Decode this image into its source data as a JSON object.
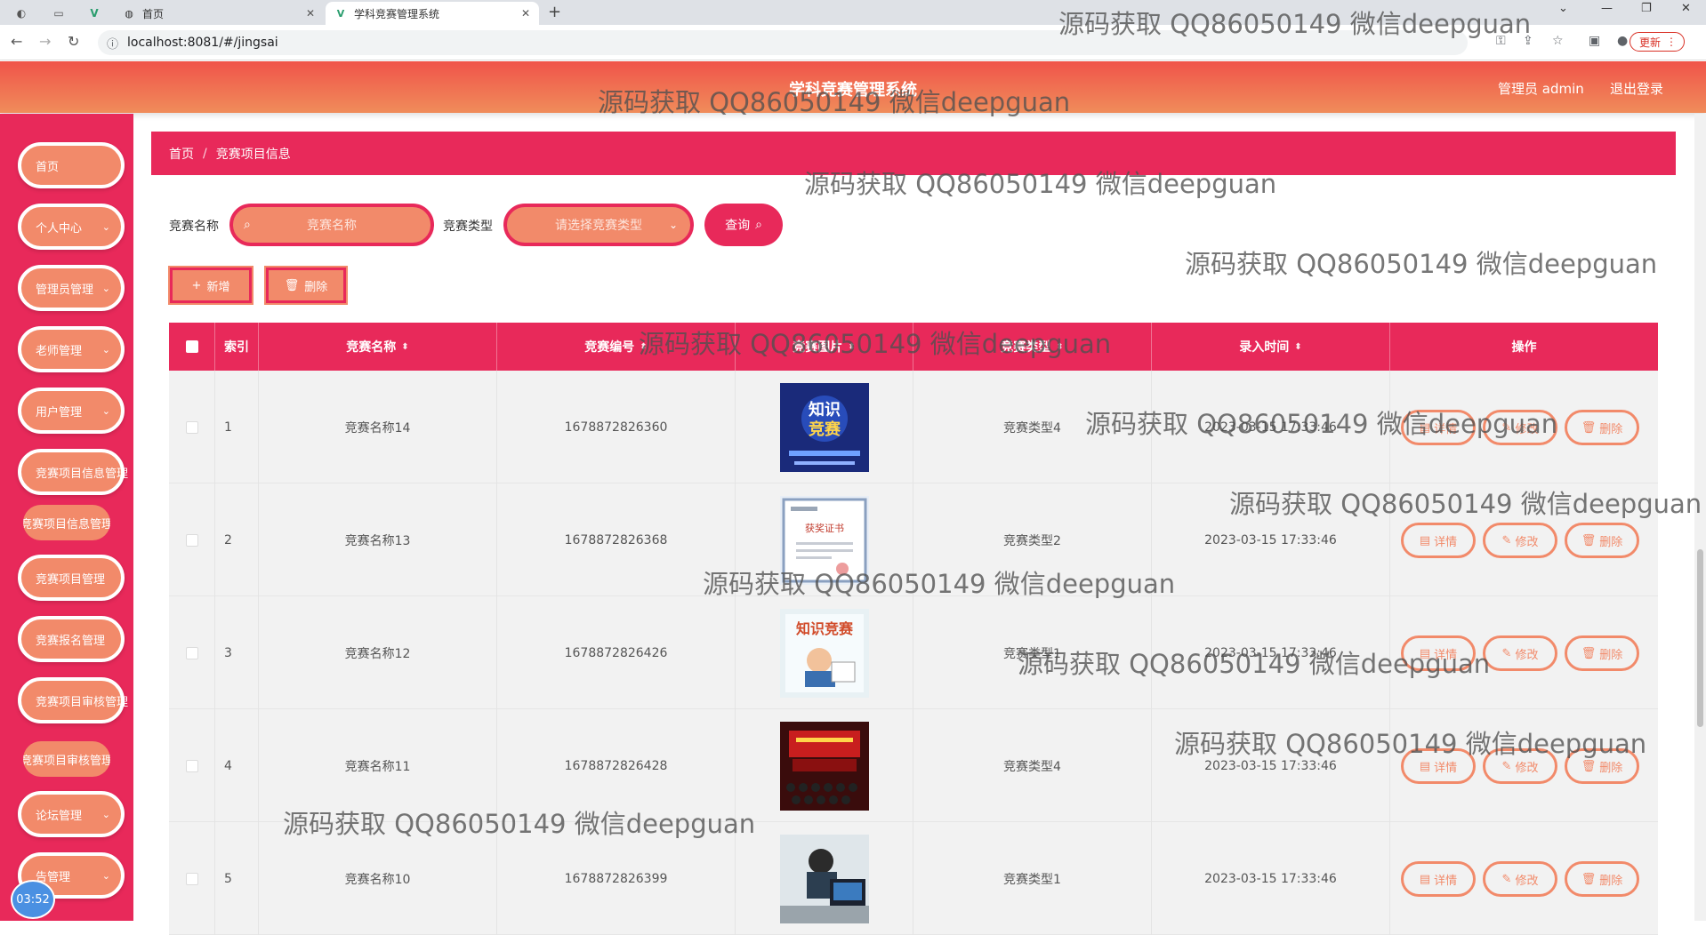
{
  "browser": {
    "tabs": [
      {
        "title": "首页",
        "active": false
      },
      {
        "title": "学科竞赛管理系统",
        "active": true
      }
    ],
    "url": "localhost:8081/#/jingsai",
    "update_label": "更新"
  },
  "header": {
    "title": "学科竞赛管理系统",
    "user": "管理员 admin",
    "logout": "退出登录"
  },
  "sidebar": {
    "items": [
      {
        "label": "首页",
        "has_sub": false
      },
      {
        "label": "个人中心",
        "has_sub": true
      },
      {
        "label": "管理员管理",
        "has_sub": true
      },
      {
        "label": "老师管理",
        "has_sub": true
      },
      {
        "label": "用户管理",
        "has_sub": true
      },
      {
        "label": "竞赛项目信息管理",
        "has_sub": true
      },
      {
        "label": "竞赛项目管理",
        "has_sub": true
      },
      {
        "label": "竞赛报名管理",
        "has_sub": true
      },
      {
        "label": "竞赛项目审核管理",
        "has_sub": true
      },
      {
        "label": "论坛管理",
        "has_sub": true
      },
      {
        "label": "告管理",
        "has_sub": true
      }
    ],
    "sub_items": [
      "竞赛项目信息管理",
      "竞赛项目审核管理"
    ],
    "timer": "03:52"
  },
  "breadcrumb": {
    "home": "首页",
    "current": "竞赛项目信息"
  },
  "search": {
    "name_label": "竞赛名称",
    "name_placeholder": "竞赛名称",
    "type_label": "竞赛类型",
    "type_placeholder": "请选择竞赛类型",
    "query_label": "查询"
  },
  "actions": {
    "add": "新增",
    "delete": "删除"
  },
  "table": {
    "columns": [
      "索引",
      "竞赛名称",
      "竞赛编号",
      "竞赛图片",
      "竞赛类型",
      "录入时间",
      "操作"
    ],
    "rows": [
      {
        "index": "1",
        "name": "竞赛名称14",
        "code": "1678872826360",
        "type": "竞赛类型4",
        "time": "2023-03-15 17:33:46",
        "image": "knowledge-contest-blue"
      },
      {
        "index": "2",
        "name": "竞赛名称13",
        "code": "1678872826368",
        "type": "竞赛类型2",
        "time": "2023-03-15 17:33:46",
        "image": "certificate"
      },
      {
        "index": "3",
        "name": "竞赛名称12",
        "code": "1678872826426",
        "type": "竞赛类型1",
        "time": "2023-03-15 17:33:46",
        "image": "knowledge-contest-poster"
      },
      {
        "index": "4",
        "name": "竞赛名称11",
        "code": "1678872826428",
        "type": "竞赛类型4",
        "time": "2023-03-15 17:33:46",
        "image": "stage-event"
      },
      {
        "index": "5",
        "name": "竞赛名称10",
        "code": "1678872826399",
        "type": "竞赛类型1",
        "time": "2023-03-15 17:33:46",
        "image": "students-computers"
      }
    ],
    "op_labels": {
      "detail": "详情",
      "edit": "修改",
      "delete": "删除"
    }
  },
  "watermark": "源码获取 QQ86050149 微信deepguan",
  "colors": {
    "primary": "#e8295a",
    "accent": "#f28a6a",
    "header_from": "#f0544a",
    "header_to": "#f08c5a"
  }
}
